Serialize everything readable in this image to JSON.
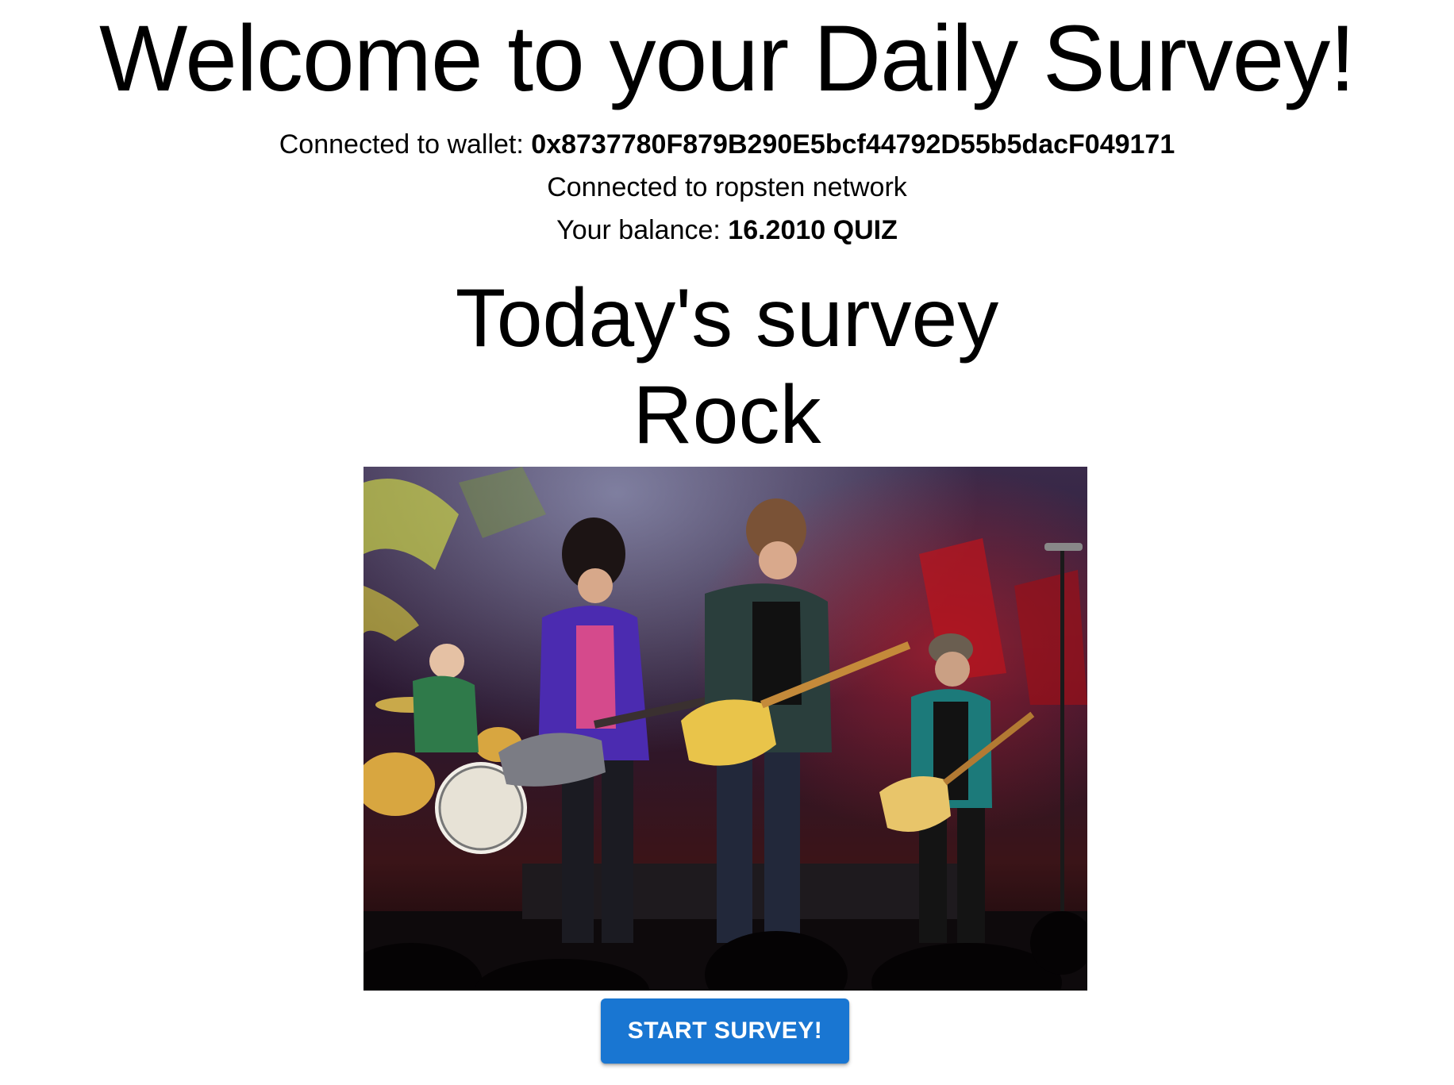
{
  "header": {
    "title": "Welcome to your Daily Survey!"
  },
  "wallet": {
    "label": "Connected to wallet: ",
    "address": "0x8737780F879B290E5bcf44792D55b5dacF049171"
  },
  "network": {
    "text": "Connected to ropsten network"
  },
  "balance": {
    "label": "Your balance: ",
    "value": "16.2010 QUIZ"
  },
  "survey": {
    "heading": "Today's survey",
    "name": "Rock",
    "image_alt": "rock-band-concert-photo"
  },
  "actions": {
    "start_label": "START SURVEY!"
  },
  "colors": {
    "button": "#1976d2",
    "button_text": "#ffffff"
  }
}
